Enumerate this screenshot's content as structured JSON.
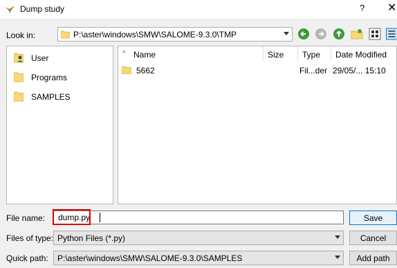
{
  "window": {
    "title": "Dump study",
    "help": "?"
  },
  "lookin": {
    "label": "Look in:",
    "path": "P:\\aster\\windows\\SMW\\SALOME-9.3.0\\TMP"
  },
  "sidebar": {
    "items": [
      {
        "label": "User",
        "icon": "user-folder-icon"
      },
      {
        "label": "Programs",
        "icon": "folder-icon"
      },
      {
        "label": "SAMPLES",
        "icon": "folder-icon"
      }
    ]
  },
  "filelist": {
    "columns": [
      "Name",
      "Size",
      "Type",
      "Date Modified"
    ],
    "rows": [
      {
        "name": "5662",
        "size": "",
        "type": "Fil...der",
        "date": "29/05/... 15:10"
      }
    ]
  },
  "form": {
    "filename_label": "File name:",
    "filename_value": "dump.py",
    "filetype_label": "Files of type:",
    "filetype_value": "Python Files (*.py)",
    "quickpath_label": "Quick path:",
    "quickpath_value": "P:\\aster\\windows\\SMW\\SALOME-9.3.0\\SAMPLES"
  },
  "buttons": {
    "save": "Save",
    "cancel": "Cancel",
    "add_path": "Add path"
  },
  "colors": {
    "accent": "#0078d7",
    "folder": "#f8d775",
    "nav_green": "#3c9a3c",
    "highlight": "#e00000"
  }
}
